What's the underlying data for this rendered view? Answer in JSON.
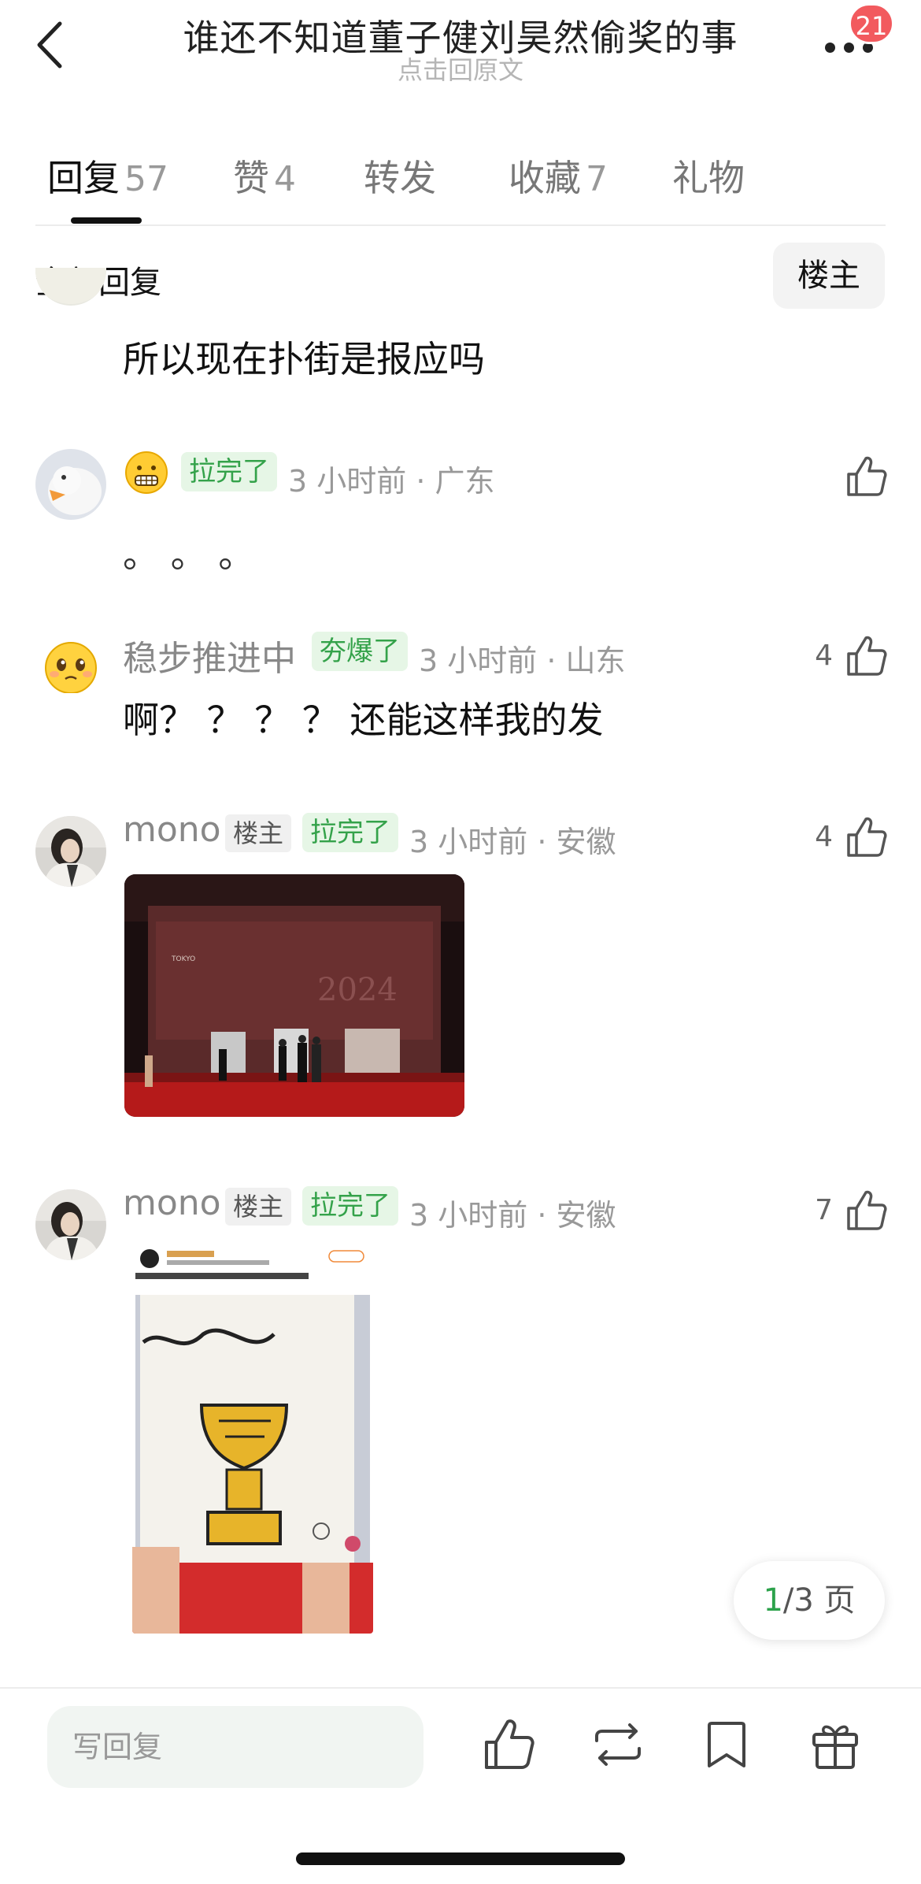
{
  "header": {
    "title": "谁还不知道董子健刘昊然偷奖的事",
    "subtitle": "点击回原文",
    "badge_count": "21"
  },
  "tabs": [
    {
      "label": "回复",
      "count": "57"
    },
    {
      "label": "赞",
      "count": "4"
    },
    {
      "label": "转发",
      "count": ""
    },
    {
      "label": "收藏",
      "count": "7"
    },
    {
      "label": "礼物",
      "count": ""
    }
  ],
  "filter": {
    "all_replies": "全部回复",
    "owner_only": "楼主"
  },
  "comments": [
    {
      "text": "所以现在扑街是报应吗"
    },
    {
      "emoji": "😬",
      "tag": "拉完了",
      "meta": "3 小时前 · 广东",
      "text": "。 。 。"
    },
    {
      "name": "稳步推进中",
      "tag": "夯爆了",
      "meta": "3 小时前 · 山东",
      "text": "啊？ ？ ？ ？ 还能这样我的发",
      "likes": "4"
    },
    {
      "name": "mono",
      "owner_tag": "楼主",
      "tag": "拉完了",
      "meta": "3 小时前 · 安徽",
      "likes": "4"
    },
    {
      "name": "mono",
      "owner_tag": "楼主",
      "tag": "拉完了",
      "meta": "3 小时前 · 安徽",
      "likes": "7"
    }
  ],
  "pagination": {
    "current": "1",
    "rest": "/3 页"
  },
  "bottom_bar": {
    "reply_placeholder": "写回复"
  },
  "icons": {
    "back": "chevron-left-icon",
    "more": "more-dots-icon",
    "like": "thumbs-up-icon",
    "repost": "repost-icon",
    "bookmark": "bookmark-icon",
    "gift": "gift-icon"
  },
  "colors": {
    "accent_green": "#34a24a",
    "badge_red": "#f25a5e"
  }
}
